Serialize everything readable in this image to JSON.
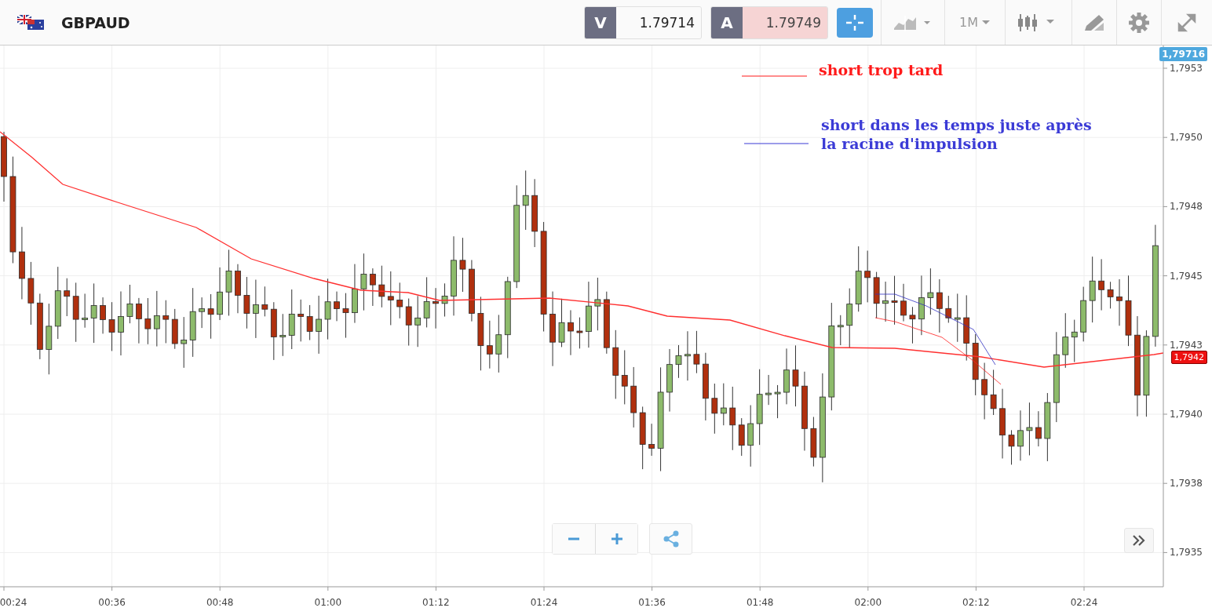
{
  "header": {
    "symbol": "GBPAUD",
    "sell": {
      "label": "V",
      "value": "1.79714"
    },
    "buy": {
      "label": "A",
      "value": "1.79749"
    },
    "timeframe": "1M"
  },
  "chart": {
    "top_price_badge": "1,79716",
    "current_price_badge": "1,7942",
    "y_ticks": [
      "1,7953",
      "1,7950",
      "1,7948",
      "1,7945",
      "1,7943",
      "1,7940",
      "1,7938",
      "1,7935"
    ],
    "x_ticks": [
      "00:24",
      "00:36",
      "00:48",
      "01:00",
      "01:12",
      "01:24",
      "01:36",
      "01:48",
      "02:00",
      "02:12",
      "02:24"
    ],
    "annotations": [
      {
        "lines": [
          "short trop tard"
        ],
        "color": "#ff1a1a"
      },
      {
        "lines": [
          "short dans les temps juste après",
          "la racine d'impulsion"
        ],
        "color": "#3b3bd6"
      }
    ]
  }
}
